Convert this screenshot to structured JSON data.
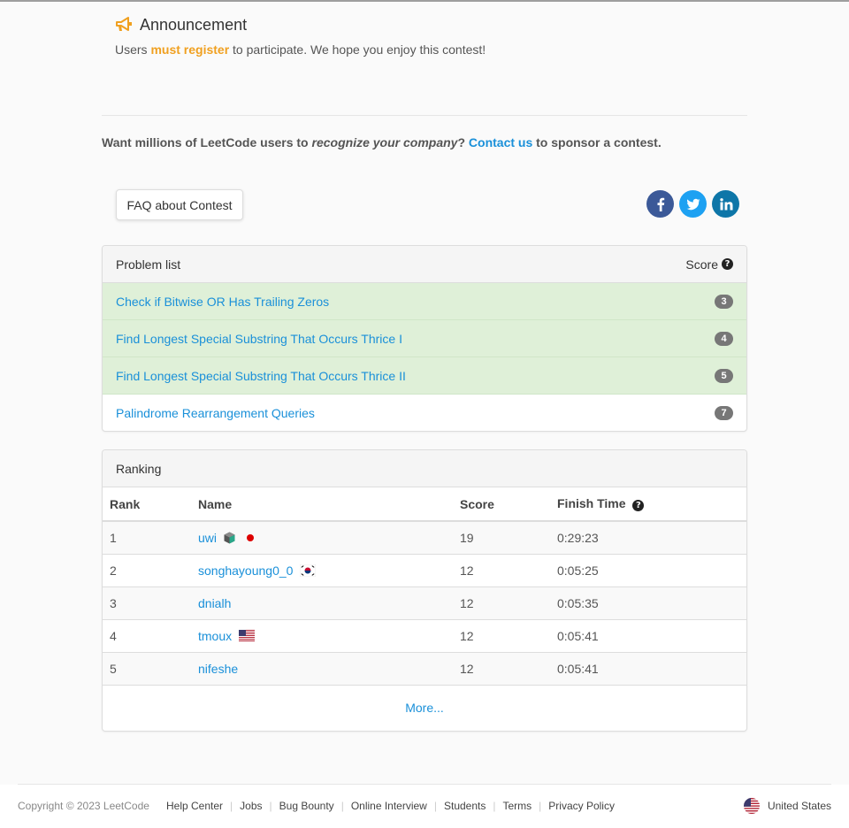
{
  "announcement": {
    "title": "Announcement",
    "text_pre": "Users ",
    "text_highlight": "must register",
    "text_post": " to participate. We hope you enjoy this contest!",
    "icon": "megaphone-icon"
  },
  "sponsor": {
    "pre": "Want millions of LeetCode users to ",
    "emphasis": "recognize your company",
    "mid": "? ",
    "link": "Contact us",
    "post": " to sponsor a contest."
  },
  "faq_button": "FAQ about Contest",
  "social": [
    "facebook-icon",
    "twitter-icon",
    "linkedin-icon"
  ],
  "problems": {
    "header": "Problem list",
    "score_header": "Score",
    "items": [
      {
        "title": "Check if Bitwise OR Has Trailing Zeros",
        "score": "3",
        "solved": true
      },
      {
        "title": "Find Longest Special Substring That Occurs Thrice I",
        "score": "4",
        "solved": true
      },
      {
        "title": "Find Longest Special Substring That Occurs Thrice II",
        "score": "5",
        "solved": true
      },
      {
        "title": "Palindrome Rearrangement Queries",
        "score": "7",
        "solved": false
      }
    ]
  },
  "ranking": {
    "header": "Ranking",
    "columns": [
      "Rank",
      "Name",
      "Score",
      "Finish Time"
    ],
    "rows": [
      {
        "rank": "1",
        "name": "uwi",
        "score": "19",
        "time": "0:29:23",
        "badges": [
          "cube-badge-icon",
          "japan-flag-icon"
        ]
      },
      {
        "rank": "2",
        "name": "songhayoung0_0",
        "score": "12",
        "time": "0:05:25",
        "badges": [
          "korea-flag-icon"
        ]
      },
      {
        "rank": "3",
        "name": "dnialh",
        "score": "12",
        "time": "0:05:35",
        "badges": []
      },
      {
        "rank": "4",
        "name": "tmoux",
        "score": "12",
        "time": "0:05:41",
        "badges": [
          "usa-flag-icon"
        ]
      },
      {
        "rank": "5",
        "name": "nifeshe",
        "score": "12",
        "time": "0:05:41",
        "badges": []
      }
    ],
    "more": "More..."
  },
  "footer": {
    "copyright": "Copyright © 2023 LeetCode",
    "links": [
      "Help Center",
      "Jobs",
      "Bug Bounty",
      "Online Interview",
      "Students",
      "Terms",
      "Privacy Policy"
    ],
    "country": "United States"
  },
  "colors": {
    "link": "#1a90d9",
    "highlight": "#f0a020",
    "solved_row": "#dff0d8",
    "badge": "#777777"
  }
}
